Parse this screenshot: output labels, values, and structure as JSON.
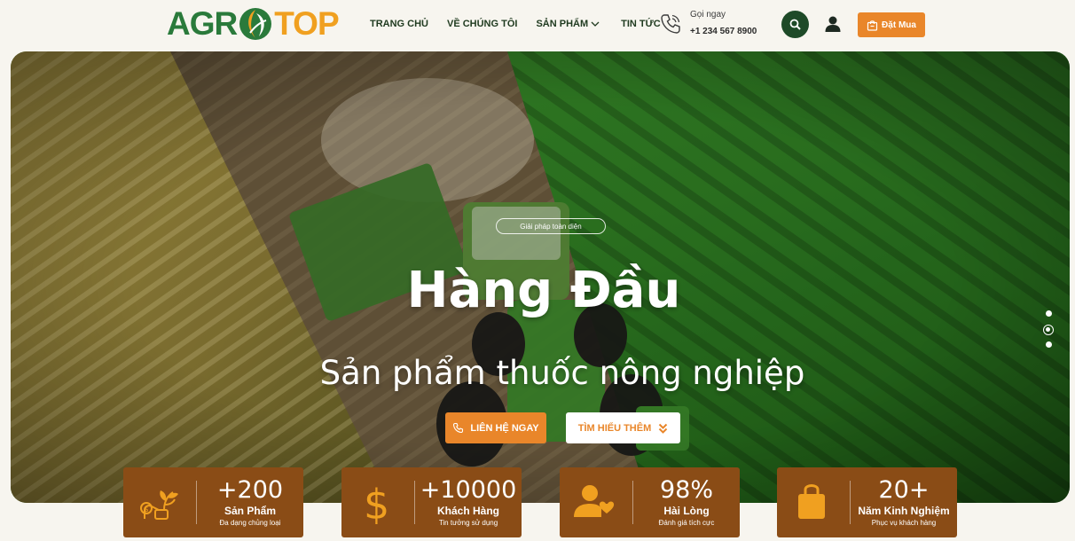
{
  "colors": {
    "brand_green": "#2a7a3b",
    "brand_orange": "#f0a020",
    "accent": "#e9862a",
    "dark_green": "#1e4a28",
    "stat_brown": "#8a4c16",
    "page_bg": "#f7f5ef"
  },
  "logo": {
    "part1": "AGR",
    "part2": "TOP",
    "icon": "leaf-globe-icon"
  },
  "nav": {
    "items": [
      {
        "label": "TRANG CHỦ"
      },
      {
        "label": "VỀ CHÚNG TÔI"
      },
      {
        "label": "SẢN PHẨM",
        "icon": "chevron-down-icon"
      },
      {
        "label": "TIN TỨC"
      }
    ]
  },
  "contact": {
    "label": "Gọi ngay",
    "phone": "+1 234 567 8900",
    "icon": "phone-icon"
  },
  "actions": {
    "search_icon": "search-icon",
    "user_icon": "user-icon",
    "order_label": "Đặt Mua",
    "order_icon": "shopping-bag-icon"
  },
  "hero": {
    "tagline": "Giải pháp toàn diện",
    "title": "Hàng Đầu",
    "subtitle": "Sản phẩm thuốc nông nghiệp",
    "cta_contact": "LIÊN HỆ NGAY",
    "cta_more": "TÌM HIỂU THÊM",
    "slides": 3,
    "active_slide": 2
  },
  "stats": [
    {
      "value": "+200",
      "label": "Sản Phẩm",
      "desc": "Đa dạng chủng loại",
      "icon": "plant-money-icon"
    },
    {
      "value": "+10000",
      "label": "Khách Hàng",
      "desc": "Tin tưởng sử dụng",
      "icon": "dollar-icon"
    },
    {
      "value": "98%",
      "label": "Hài Lòng",
      "desc": "Đánh giá tích cực",
      "icon": "user-heart-icon"
    },
    {
      "value": "20+",
      "label": "Năm Kinh Nghiệm",
      "desc": "Phục vụ khách hàng",
      "icon": "shopping-bag-icon"
    }
  ]
}
